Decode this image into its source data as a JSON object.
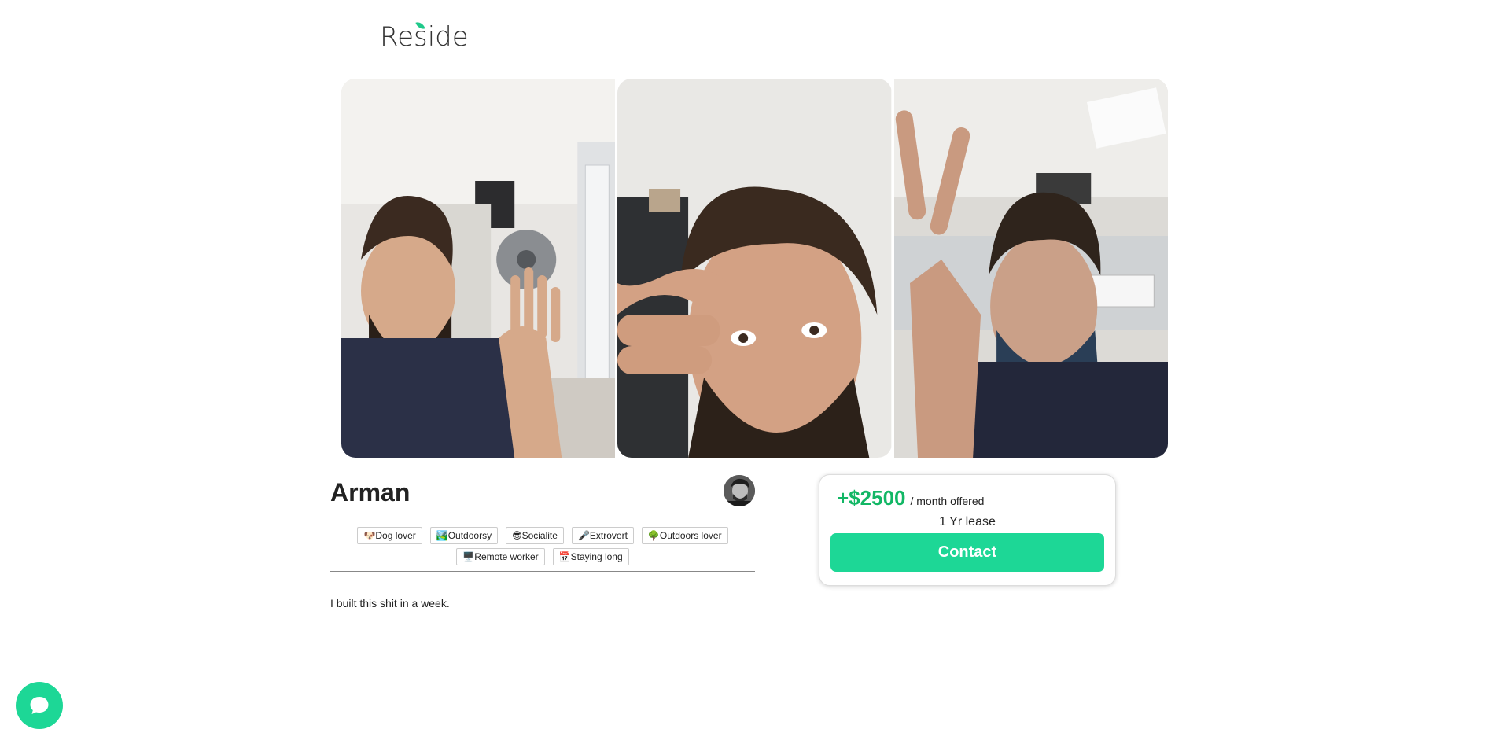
{
  "brand": {
    "name": "Reside",
    "accent": "#1dd796",
    "price_color": "#12b765"
  },
  "gallery": {
    "photos": [
      {
        "alt": "Selfie in living room with raised hand"
      },
      {
        "alt": "Selfie with hand on forehead"
      },
      {
        "alt": "Selfie with peace sign"
      }
    ]
  },
  "profile": {
    "name": "Arman",
    "tags": [
      {
        "emoji": "🐶",
        "label": "Dog lover"
      },
      {
        "emoji": "🏞️",
        "label": "Outdoorsy"
      },
      {
        "emoji": "😎",
        "label": "Socialite"
      },
      {
        "emoji": "🎤",
        "label": "Extrovert"
      },
      {
        "emoji": "🌳",
        "label": "Outdoors lover"
      },
      {
        "emoji": "🖥️",
        "label": "Remote worker"
      },
      {
        "emoji": "📅",
        "label": "Staying long"
      }
    ],
    "bio": "I built this shit in a week."
  },
  "offer": {
    "price": "+$2500",
    "period": "/ month offered",
    "lease": "1 Yr lease",
    "contact_label": "Contact"
  },
  "chat": {
    "icon": "chat-bubble-icon"
  }
}
